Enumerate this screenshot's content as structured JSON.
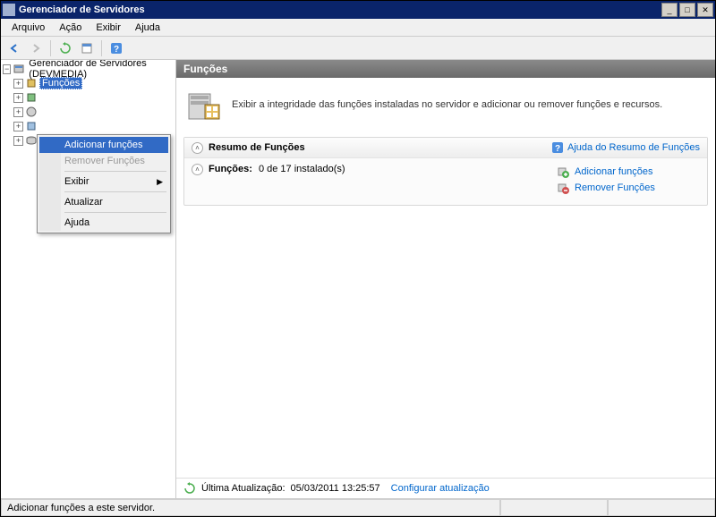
{
  "window": {
    "title": "Gerenciador de Servidores"
  },
  "menubar": {
    "arquivo": "Arquivo",
    "acao": "Ação",
    "exibir": "Exibir",
    "ajuda": "Ajuda"
  },
  "tree": {
    "root": "Gerenciador de Servidores (DEVMEDIA)",
    "funcoes": "Funções"
  },
  "context_menu": {
    "adicionar": "Adicionar funções",
    "remover": "Remover Funções",
    "exibir": "Exibir",
    "atualizar": "Atualizar",
    "ajuda": "Ajuda"
  },
  "content": {
    "header": "Funções",
    "intro": "Exibir a integridade das funções instaladas no servidor e adicionar ou remover funções e recursos."
  },
  "summary": {
    "title": "Resumo de Funções",
    "help": "Ajuda do Resumo de Funções",
    "roles_label": "Funções:",
    "roles_value": "0 de 17 instalado(s)",
    "action_add": "Adicionar funções",
    "action_remove": "Remover Funções"
  },
  "footer": {
    "last_update_label": "Última Atualização:",
    "last_update_value": "05/03/2011 13:25:57",
    "configure": "Configurar atualização"
  },
  "statusbar": {
    "text": "Adicionar funções a este servidor."
  }
}
